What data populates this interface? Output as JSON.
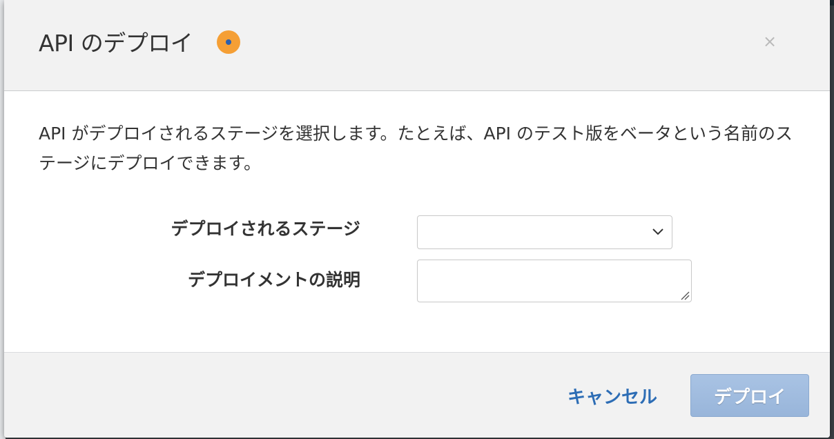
{
  "modal": {
    "title": "API のデプロイ",
    "info_icon": "info-icon",
    "close_label": "×",
    "description": "API がデプロイされるステージを選択します。たとえば、API のテスト版をベータという名前のステージにデプロイできます。"
  },
  "form": {
    "stage_label": "デプロイされるステージ",
    "stage_value": "",
    "description_label": "デプロイメントの説明",
    "description_value": ""
  },
  "footer": {
    "cancel_label": "キャンセル",
    "deploy_label": "デプロイ"
  },
  "colors": {
    "info_icon_bg": "#f59f35",
    "info_icon_dot": "#2b5fae",
    "link": "#2d6db5",
    "primary_button": "#a9c3e4"
  }
}
